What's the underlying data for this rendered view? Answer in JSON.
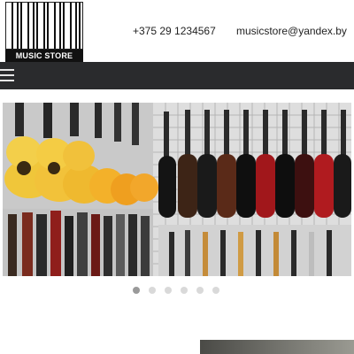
{
  "logo": {
    "text": "MUSIC STORE"
  },
  "contacts": {
    "phone": "+375 29 1234567",
    "email": "musicstore@yandex.by"
  },
  "nav": {
    "menu_icon": "hamburger-menu-icon"
  },
  "slider": {
    "image": "guitar-wall-photo",
    "slides": 6,
    "active_slide": 1
  },
  "colors": {
    "navbar": "#2a2b2d",
    "dot_active": "#9a9a9a",
    "dot_inactive": "#d9d9d9"
  }
}
